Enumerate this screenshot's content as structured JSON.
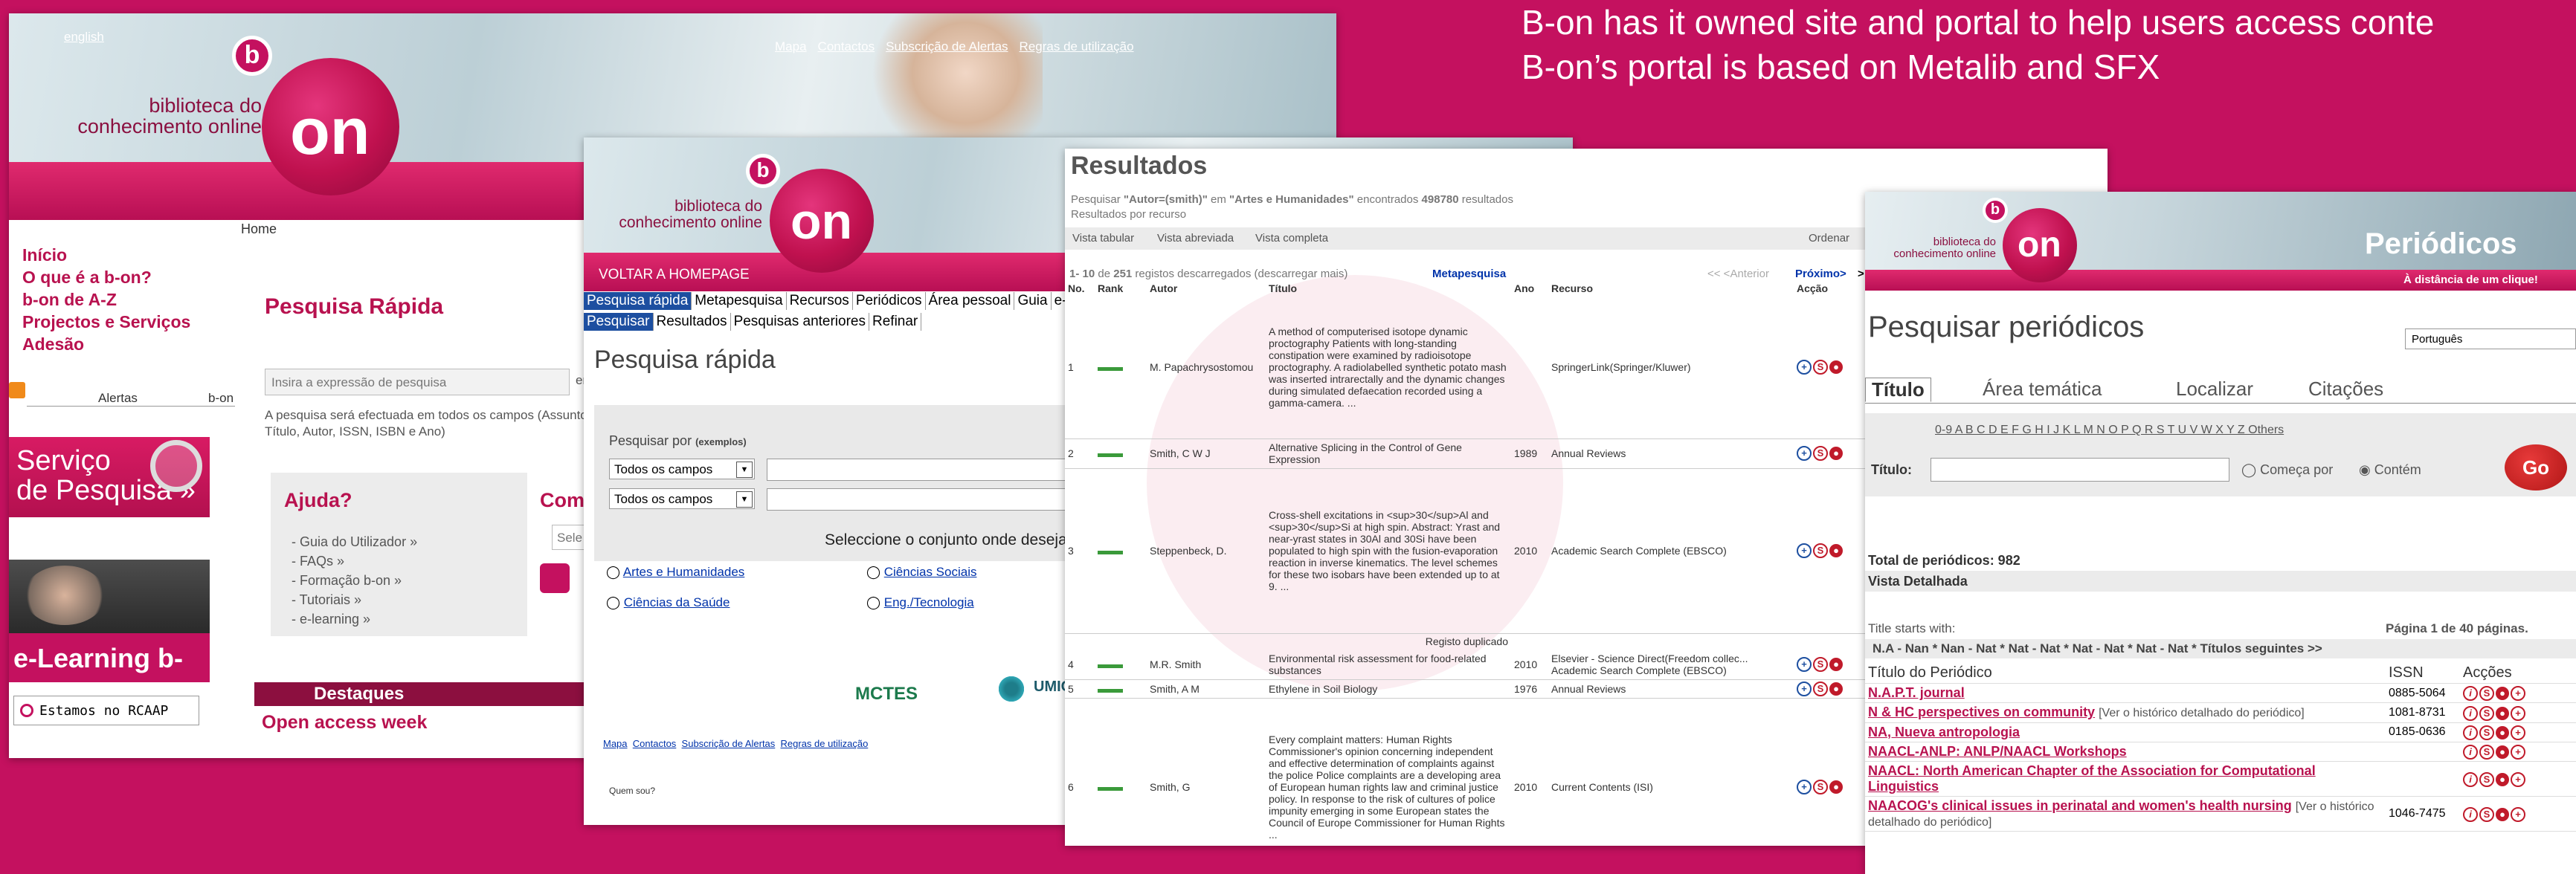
{
  "caption": {
    "line1": "B-on has it owned  site and portal to help users access conte",
    "line2": "B-on’s portal is based on Metalib and SFX"
  },
  "shot1": {
    "lang": "english",
    "logo_line1": "biblioteca do",
    "logo_line2": "conhecimento online",
    "logo_b": "b",
    "logo_on": "on",
    "top_links": [
      "Mapa",
      "Contactos",
      "Subscrição de Alertas",
      "Regras de utilização"
    ],
    "home_label": "Home",
    "nav": [
      "Início",
      "O que é a b-on?",
      "b-on de A-Z",
      "Projectos e Serviços",
      "Adesão"
    ],
    "rss_alerts": "Alertas",
    "rss_bon": "b-on",
    "servico_line1": "Serviço",
    "servico_line2": "de Pesquisa »",
    "elearning": "e-Learning b-on",
    "rcaap": "Estamos no RCAAP",
    "pesquisa_title": "Pesquisa Rápida",
    "search_placeholder": "Insira a  expressão de pesquisa",
    "search_cut": "en",
    "search_note": "A pesquisa será efectuada em todos os campos (Assunto, Título, Autor, ISSN, ISBN e Ano)",
    "ajuda_title": "Ajuda?",
    "ajuda_links": [
      "- Guia do Utilizador »",
      "- FAQs »",
      "- Formação b-on »",
      "- Tutoriais »",
      "- e-learning »"
    ],
    "com_title": "Com",
    "sel_placeholder": "Sele",
    "destaques": "Destaques",
    "open_access": "Open access week"
  },
  "shot2": {
    "logo_line1": "biblioteca do",
    "logo_line2": "conhecimento online",
    "logo_b": "b",
    "logo_on": "on",
    "voltar": "VOLTAR A HOMEPAGE",
    "tabs": [
      "Pesquisa rápida",
      "Metapesquisa",
      "Recursos",
      "Periódicos",
      "Área pessoal",
      "Guia",
      "e-"
    ],
    "subtabs": [
      "Pesquisar",
      "Resultados",
      "Pesquisas anteriores",
      "Refinar"
    ],
    "title": "Pesquisa rápida",
    "pesquisar_por": "Pesquisar por",
    "exemplos": "(exemplos)",
    "select1": "Todos os campos",
    "select2": "Todos os campos",
    "seleccione": "Seleccione o conjunto onde deseja",
    "radios": [
      "Artes e Humanidades",
      "Ciências Sociais",
      "Ciências da Saúde",
      "Eng./Tecnologia"
    ],
    "mctes": "MCTES",
    "umic": "UMIC",
    "footer_links": [
      "Mapa",
      "Contactos",
      "Subscrição de Alertas",
      "Regras de utilização"
    ],
    "quem_sou": "Quem sou?"
  },
  "shot3": {
    "title": "Resultados",
    "query_prefix": "Pesquisar ",
    "query_author": "\"Autor=(smith)\"",
    "query_mid": " em ",
    "query_set": "\"Artes e Humanidades\"",
    "query_found": " encontrados ",
    "query_count": "498780",
    "query_suffix": " resultados",
    "by_resource": "Resultados por recurso",
    "views": [
      "Vista tabular",
      "Vista abreviada",
      "Vista completa"
    ],
    "ordenar": "Ordenar",
    "range_bold": "1- 10",
    "range_mid": " de ",
    "range_total": "251",
    "range_rest": " registos descarregados (descarregar mais)",
    "metapesquisa": "Metapesquisa",
    "prev": "<< <Anterior",
    "next": "Próximo>",
    "next_more": ">",
    "cols": [
      "No.",
      "Rank",
      "Autor",
      "Título",
      "Ano",
      "Recurso",
      "Acção"
    ],
    "rows": [
      {
        "no": "1",
        "autor": "M. Papachrysostomou",
        "titulo": "A method of computerised isotope dynamic proctography Patients with long-standing constipation were examined by radioisotope proctography. A radiolabelled synthetic potato mash was inserted intrarectally and the dynamic changes during simulated defaecation recorded using a gamma-camera. ...",
        "ano": "",
        "recurso": "SpringerLink(Springer/Kluwer)"
      },
      {
        "no": "2",
        "autor": "Smith, C W J",
        "titulo": "Alternative Splicing in the Control of Gene Expression",
        "ano": "1989",
        "recurso": "Annual Reviews"
      },
      {
        "no": "3",
        "autor": "Steppenbeck, D.",
        "titulo": "Cross-shell excitations in <sup>30</sup>Al and <sup>30</sup>Si at high spin. Abstract: Yrast and near-yrast states in 30Al and 30Si have been populated to high spin with the fusion-evaporation reaction in inverse kinematics. The level schemes for these two isobars have been extended up to at 9. ...",
        "ano": "2010",
        "recurso": "Academic Search Complete (EBSCO)"
      },
      {
        "no": "4",
        "autor": "M.R. Smith",
        "titulo": "Environmental risk assessment for food-related substances",
        "ano": "2010",
        "recurso": "Elsevier - Science Direct(Freedom collec... Academic Search Complete (EBSCO)"
      },
      {
        "no": "5",
        "autor": "Smith, A M",
        "titulo": "Ethylene in Soil Biology",
        "ano": "1976",
        "recurso": "Annual Reviews"
      },
      {
        "no": "6",
        "autor": "Smith, G",
        "titulo": "Every complaint matters: Human Rights Commissioner's opinion concerning independent and effective determination of complaints against the police Police complaints are a developing area of European human rights law and criminal justice policy. In response to the risk of cultures of police impunity emerging in some European states the Council of Europe Commissioner for Human Rights ...",
        "ano": "2010",
        "recurso": "Current Contents (ISI)"
      }
    ],
    "registo_duplicado": "Registo duplicado"
  },
  "shot4": {
    "logo_line1": "biblioteca do",
    "logo_line2": "conhecimento online",
    "logo_b": "b",
    "logo_on": "on",
    "periodicos": "Periódicos",
    "tagline": "À distância de um clique!",
    "title": "Pesquisar periódicos",
    "lang_select": "Português",
    "tabs": [
      "Título",
      "Área temática",
      "Localizar",
      "Citações"
    ],
    "alpha": "0-9 A B C D E F G H I J K L M N O P Q R S T U V W X Y Z Others",
    "titulo_label": "Título:",
    "comeca": "Começa por",
    "contem": "Contém",
    "go": "Go",
    "total": "Total de periódicos: 982",
    "vista": "Vista Detalhada",
    "title_starts": "Title starts with:",
    "pagina": "Página 1 de 40 páginas.",
    "ranges": "N.A - Nan * Nan - Nat * Nat - Nat * Nat - Nat * Nat - Nat * Títulos seguintes >>",
    "col_titulo": "Título do Periódico",
    "col_issn": "ISSN",
    "col_accoes": "Acções",
    "journals": [
      {
        "title": "N.A.P.T. journal",
        "note": "",
        "issn": "0885-5064"
      },
      {
        "title": "N & HC perspectives on community",
        "note": "[Ver o histórico detalhado do periódico]",
        "issn": "1081-8731"
      },
      {
        "title": "NA, Nueva antropologia",
        "note": "",
        "issn": "0185-0636"
      },
      {
        "title": "NAACL-ANLP: ANLP/NAACL Workshops",
        "note": "",
        "issn": ""
      },
      {
        "title": "NAACL: North American Chapter of the Association for Computational Linguistics",
        "note": "",
        "issn": ""
      },
      {
        "title": "NAACOG's clinical issues in perinatal and women's health nursing",
        "note": "[Ver o histórico detalhado do periódico]",
        "issn": "1046-7475"
      }
    ]
  }
}
